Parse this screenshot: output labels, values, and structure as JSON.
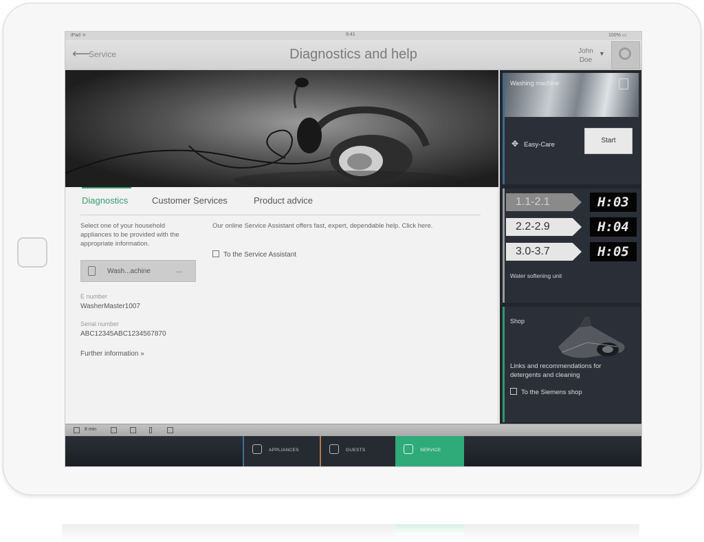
{
  "statusbar": {
    "carrier": "iPad ᯤ",
    "time": "9:41",
    "battery": "100% ▭"
  },
  "navbar": {
    "back_label": "Service",
    "title": "Diagnostics and help",
    "user_first": "John",
    "user_last": "Doe",
    "caret": "▼"
  },
  "tabs": [
    {
      "label": "Diagnostics",
      "active": true
    },
    {
      "label": "Customer Services",
      "active": false
    },
    {
      "label": "Product advice",
      "active": false
    }
  ],
  "diagnostics": {
    "instruction": "Select one of your household appliances to be provided with the appropriate information.",
    "appliance": {
      "label": "Wash...achine",
      "more": "..."
    },
    "enumber_label": "E number",
    "enumber_value": "WasherMaster1007",
    "serial_label": "Serial number",
    "serial_value": "ABC12345ABC1234567870",
    "further_link": "Further information »",
    "assistant_text": "Our online Service Assistant offers fast, expert, dependable help. Click here.",
    "assistant_link": "To the Service Assistant"
  },
  "toolbar": {
    "label": "8 min"
  },
  "bottom_nav": [
    {
      "label": "APPLIANCES",
      "icon": "appliance-icon"
    },
    {
      "label": "GUESTS",
      "icon": "guests-icon"
    },
    {
      "label": "SERVICE",
      "icon": "service-icon",
      "active": true
    }
  ],
  "right_panel": {
    "washing_machine": {
      "title": "Washing machine",
      "easycare": "Easy-Care",
      "start": "Start"
    },
    "water_softening": {
      "rows": [
        {
          "value": "1.1-2.1",
          "display": "H:03"
        },
        {
          "value": "2.2-2.9",
          "display": "H:04"
        },
        {
          "value": "3.0-3.7",
          "display": "H:05"
        }
      ],
      "label": "Water softening unit"
    },
    "shop": {
      "title": "Shop",
      "description": "Links and recommendations for detergents and cleaning",
      "link": "To the Siemens shop"
    }
  },
  "colors": {
    "accent_green": "#3a9b72",
    "panel_dark": "#22262c",
    "service_green": "#2faa79"
  }
}
